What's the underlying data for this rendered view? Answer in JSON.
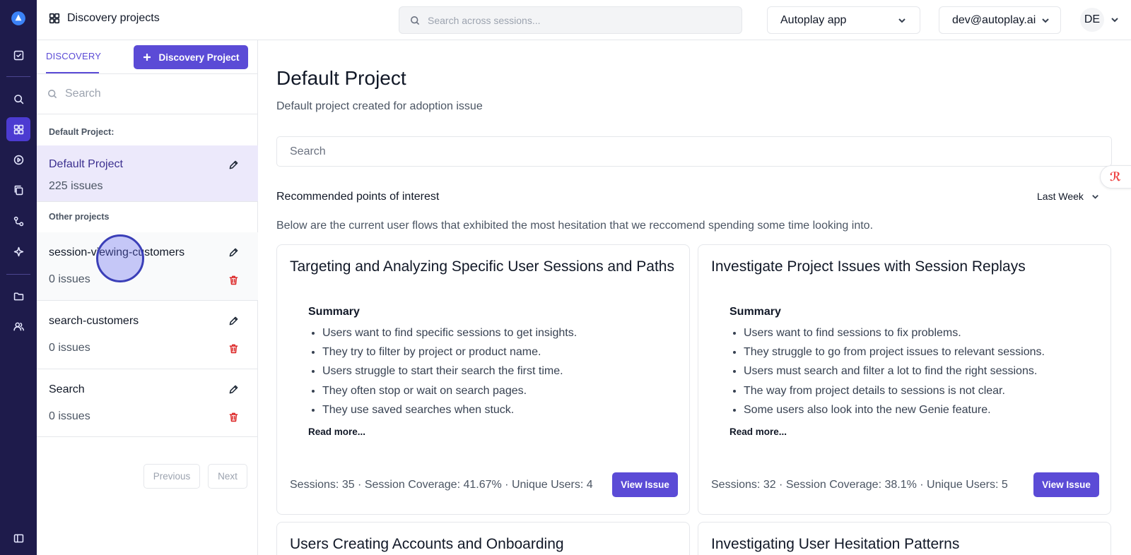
{
  "colors": {
    "rail": "#1e1b4b",
    "accent": "#5b4bd6",
    "danger": "#dc2626"
  },
  "rail": {
    "icons": [
      "logo-icon",
      "tasks-icon",
      "search-icon",
      "dashboard-icon",
      "play-icon",
      "copy-icon",
      "flow-icon",
      "sparkle-icon",
      "folder-icon",
      "users-icon",
      "sidebar-toggle-icon"
    ]
  },
  "topbar": {
    "title": "Discovery projects",
    "search_placeholder": "Search across sessions...",
    "app_select": "Autoplay app",
    "account_select": "dev@autoplay.ai",
    "avatar": "DE"
  },
  "sidebar": {
    "tab": "DISCOVERY",
    "new_button": "Discovery Project",
    "search_placeholder": "Search",
    "default_label": "Default Project:",
    "default_project": {
      "name": "Default Project",
      "count": "225 issues"
    },
    "other_label": "Other projects",
    "projects": [
      {
        "name": "session-viewing-customers",
        "count": "0 issues"
      },
      {
        "name": "search-customers",
        "count": "0 issues"
      },
      {
        "name": "Search",
        "count": "0 issues"
      }
    ],
    "pager": {
      "previous": "Previous",
      "next": "Next"
    }
  },
  "main": {
    "title": "Default Project",
    "subtitle": "Default project created for adoption issue",
    "search_placeholder": "Search",
    "poi_title": "Recommended points of interest",
    "period": "Last Week",
    "poi_desc": "Below are the current user flows that exhibited the most hesitation that we reccomend spending some time looking into.",
    "cards": [
      {
        "title": "Targeting and Analyzing Specific User Sessions and Paths",
        "summary_label": "Summary",
        "bullets": [
          "Users want to find specific sessions to get insights.",
          "They try to filter by project or product name.",
          "Users struggle to start their search the first time.",
          "They often stop or wait on search pages.",
          "They use saved searches when stuck."
        ],
        "read_more": "Read more...",
        "stats": "Sessions: 35 · Session Coverage: 41.67% · Unique Users: 4",
        "button": "View Issue"
      },
      {
        "title": "Investigate Project Issues with Session Replays",
        "summary_label": "Summary",
        "bullets": [
          "Users want to find sessions to fix problems.",
          "They struggle to go from project issues to relevant sessions.",
          "Users must search and filter a lot to find the right sessions.",
          "The way from project details to sessions is not clear.",
          "Some users also look into the new Genie feature."
        ],
        "read_more": "Read more...",
        "stats": "Sessions: 32 · Session Coverage: 38.1% · Unique Users: 5",
        "button": "View Issue"
      },
      {
        "title": "Users Creating Accounts and Onboarding"
      },
      {
        "title": "Investigating User Hesitation Patterns"
      }
    ]
  }
}
